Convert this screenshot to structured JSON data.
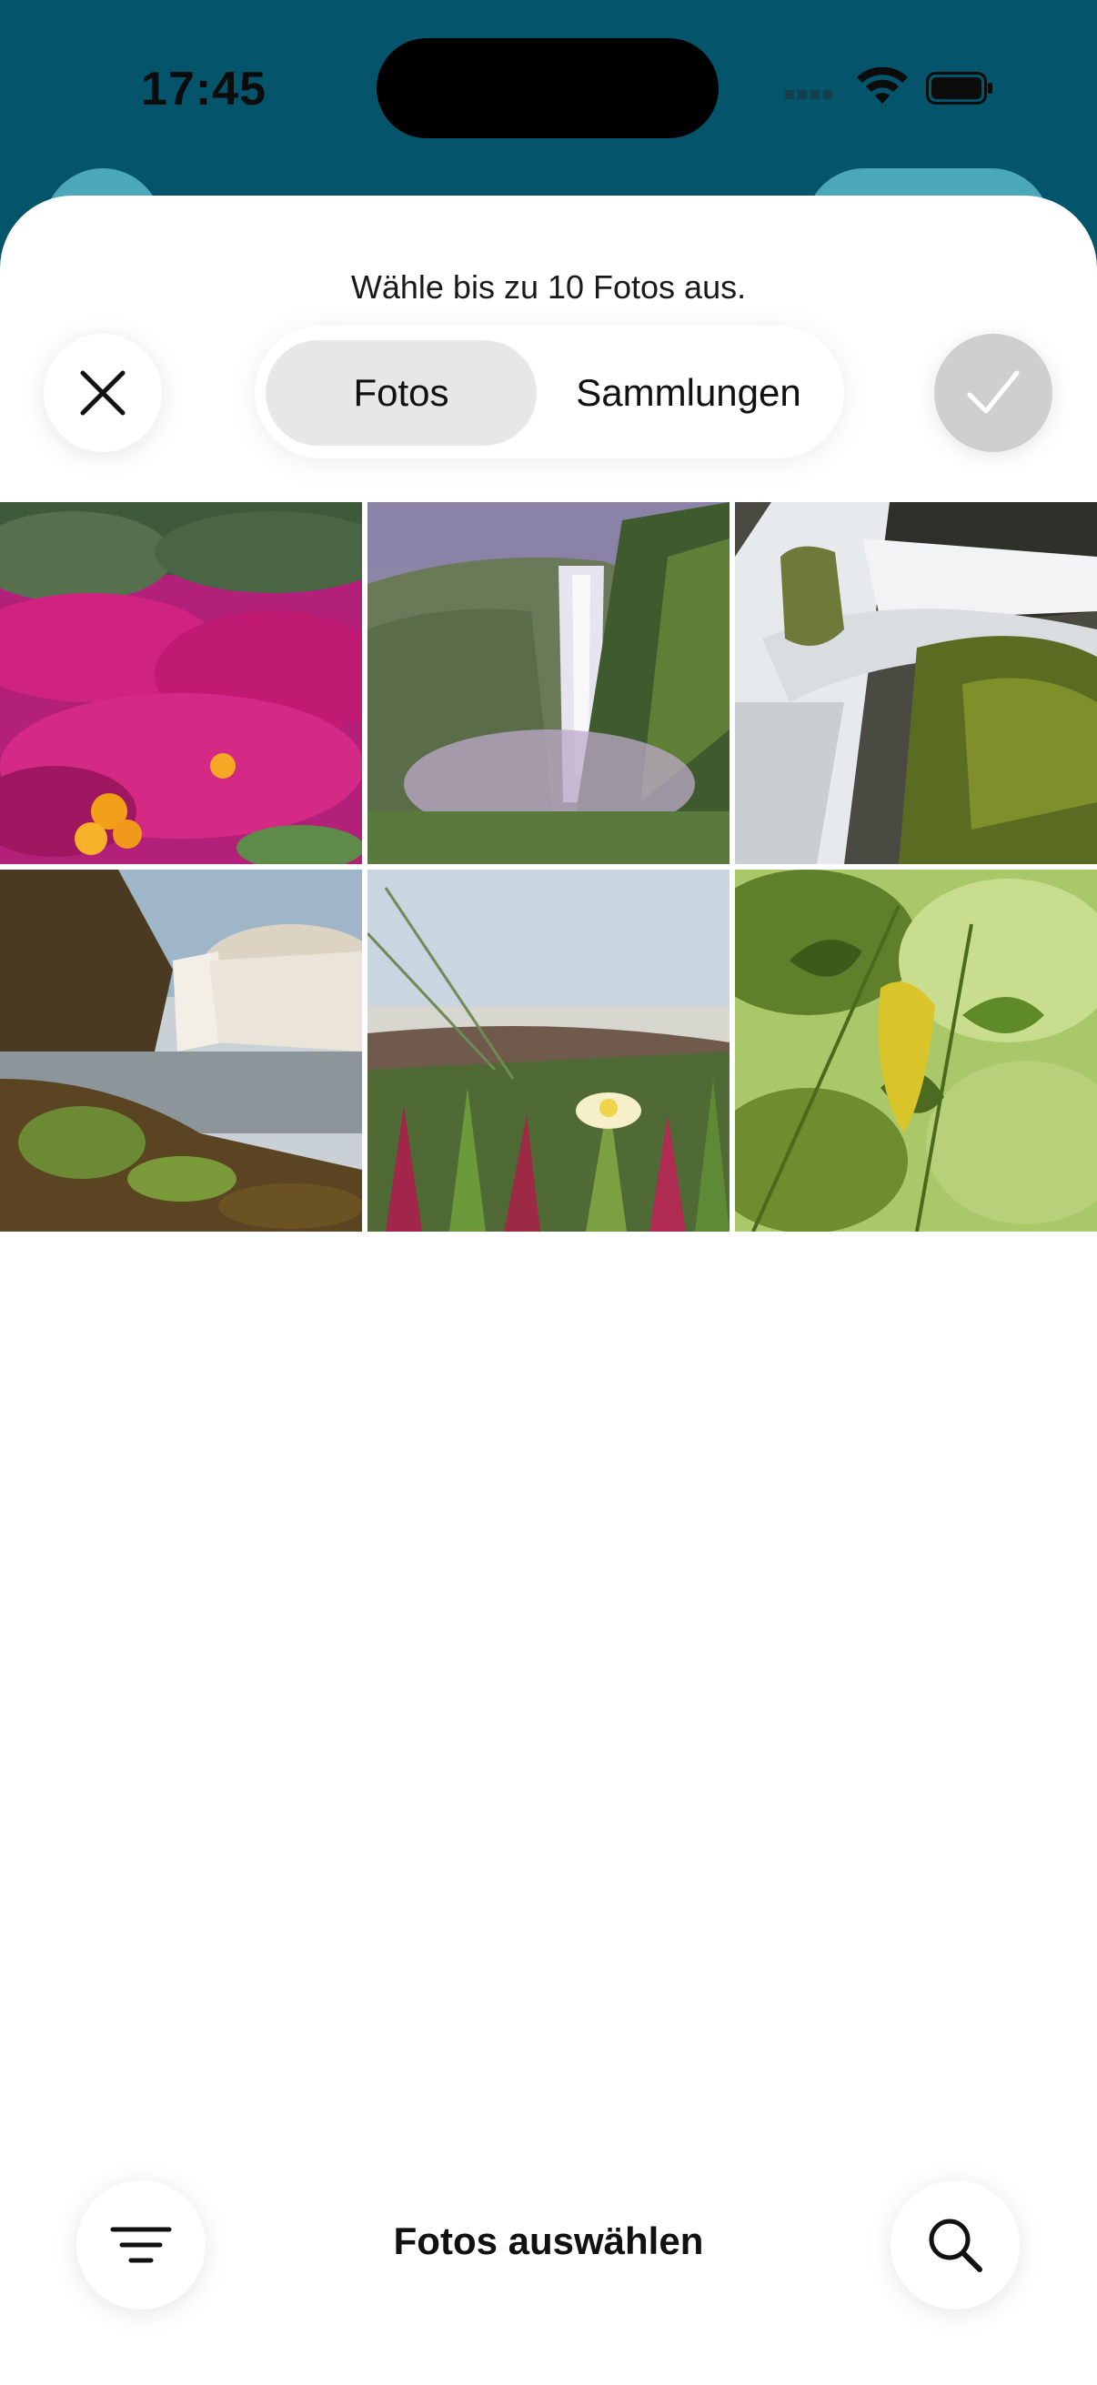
{
  "status_bar": {
    "time": "17:45"
  },
  "picker": {
    "subtitle": "Wähle bis zu 10 Fotos aus.",
    "tabs": [
      {
        "label": "Fotos",
        "selected": true
      },
      {
        "label": "Sammlungen",
        "selected": false
      }
    ],
    "photos": [
      {
        "subject": "pink-flowers"
      },
      {
        "subject": "waterfall-cliff"
      },
      {
        "subject": "waterfall-rocks"
      },
      {
        "subject": "waterfall-coast"
      },
      {
        "subject": "dune-flower"
      },
      {
        "subject": "green-leaves"
      }
    ]
  },
  "bottom_bar": {
    "title": "Fotos auswählen"
  },
  "icons": {
    "close": "close-icon",
    "confirm": "checkmark-icon",
    "filter": "filter-lines-icon",
    "search": "search-icon"
  },
  "colors": {
    "header_bg": "#04546c",
    "accent_pill": "#4aa8b8",
    "segment_active": "#e7e7e7",
    "confirm_disabled": "#cfcfcf"
  }
}
